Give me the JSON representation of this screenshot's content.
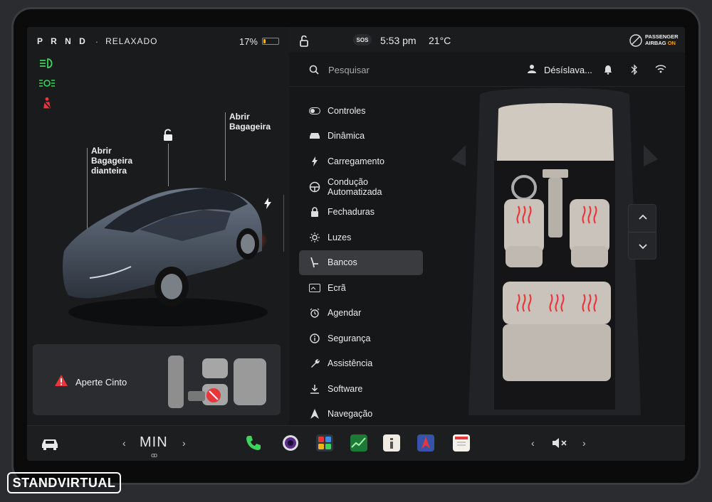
{
  "status": {
    "gears": "P R N D",
    "separator": "·",
    "drive_mode": "RELAXADO",
    "battery_percent": "17%",
    "battery_level": 0.17,
    "time": "5:53 pm",
    "temperature": "21°C",
    "sos_label": "SOS",
    "airbag_line1": "PASSENGER",
    "airbag_line2": "AIRBAG",
    "airbag_state": "ON"
  },
  "indicators": [
    "low-beam-icon",
    "parking-lights-icon",
    "seatbelt-warning-icon"
  ],
  "callouts": {
    "frunk": "Abrir\nBagageira\ndianteira",
    "trunk": "Abrir\nBagageira"
  },
  "alert": {
    "text": "Aperte Cinto"
  },
  "search": {
    "placeholder": "Pesquisar",
    "user": "Désíslava..."
  },
  "menu": [
    {
      "label": "Controles",
      "icon": "toggle-icon"
    },
    {
      "label": "Dinâmica",
      "icon": "car-icon"
    },
    {
      "label": "Carregamento",
      "icon": "bolt-icon"
    },
    {
      "label": "Condução\nAutomatizada",
      "icon": "steering-wheel-icon"
    },
    {
      "label": "Fechaduras",
      "icon": "lock-icon"
    },
    {
      "label": "Luzes",
      "icon": "sun-icon"
    },
    {
      "label": "Bancos",
      "icon": "seat-icon",
      "active": true
    },
    {
      "label": "Ecrã",
      "icon": "display-icon"
    },
    {
      "label": "Agendar",
      "icon": "alarm-icon"
    },
    {
      "label": "Segurança",
      "icon": "info-icon"
    },
    {
      "label": "Assistência",
      "icon": "wrench-icon"
    },
    {
      "label": "Software",
      "icon": "download-icon"
    },
    {
      "label": "Navegação",
      "icon": "navigation-icon"
    }
  ],
  "taskbar": {
    "fan_level": "MIN",
    "apps": [
      "phone-icon",
      "camera-icon",
      "arcade-icon",
      "energy-icon",
      "manual-icon",
      "maps-icon",
      "calendar-icon"
    ]
  },
  "colors": {
    "accent_green": "#3ed35b",
    "warning_red": "#e8363a",
    "battery_yellow": "#f2b21c",
    "airbag_on": "#f2a21c"
  },
  "watermark": "STANDVIRTUAL"
}
